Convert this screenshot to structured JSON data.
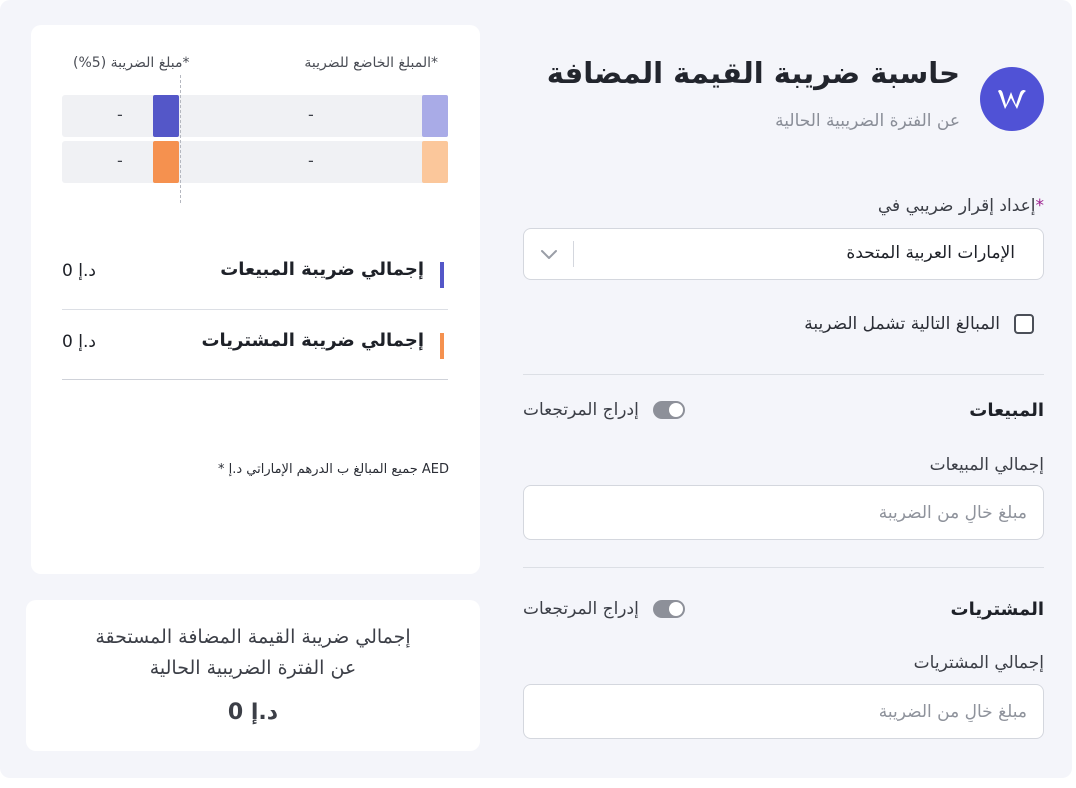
{
  "header": {
    "title": "حاسبة ضريبة القيمة المضافة",
    "subtitle": "عن الفترة الضريبية الحالية"
  },
  "form": {
    "country_label": "إعداد إقرار ضريبي في",
    "required_mark": "*",
    "country_value": "الإمارات العربية المتحدة",
    "includes_tax_label": "المبالغ التالية تشمل الضريبة",
    "includes_tax_checked": false,
    "sales": {
      "title": "المبيعات",
      "returns_toggle_label": "إدراج المرتجعات",
      "total_label": "إجمالي المبيعات",
      "input_placeholder": "مبلغ خالٍ من الضريبة",
      "input_value": ""
    },
    "purchases": {
      "title": "المشتريات",
      "returns_toggle_label": "إدراج المرتجعات",
      "total_label": "إجمالي المشتريات",
      "input_placeholder": "مبلغ خالٍ من الضريبة",
      "input_value": ""
    }
  },
  "summary": {
    "taxable_header": "المبلغ الخاضع للضريبة*",
    "tax_header": "مبلغ الضريبة (5%)*",
    "rows": [
      {
        "taxable": "-",
        "tax": "-"
      },
      {
        "taxable": "-",
        "tax": "-"
      }
    ],
    "sales_tax_total_label": "إجمالي ضريبة المبيعات",
    "sales_tax_total_value": "0 د.إ",
    "purchases_tax_total_label": "إجمالي ضريبة المشتريات",
    "purchases_tax_total_value": "0 د.إ",
    "footnote": "* جميع المبالغ ب الدرهم الإماراتي د.إ AED"
  },
  "due": {
    "line1": "إجمالي ضريبة القيمة المضافة المستحقة",
    "line2": "عن الفترة الضريبية الحالية",
    "value": "0 د.إ"
  },
  "colors": {
    "brand": "#5052d6",
    "sales": "#5457c8",
    "sales_light": "#a9abe7",
    "purchases": "#f5914f",
    "purchases_light": "#fbc79b",
    "required": "#9b1f8e"
  },
  "icons": {
    "logo": "w-logo-icon",
    "select": "chevron-down-icon"
  }
}
